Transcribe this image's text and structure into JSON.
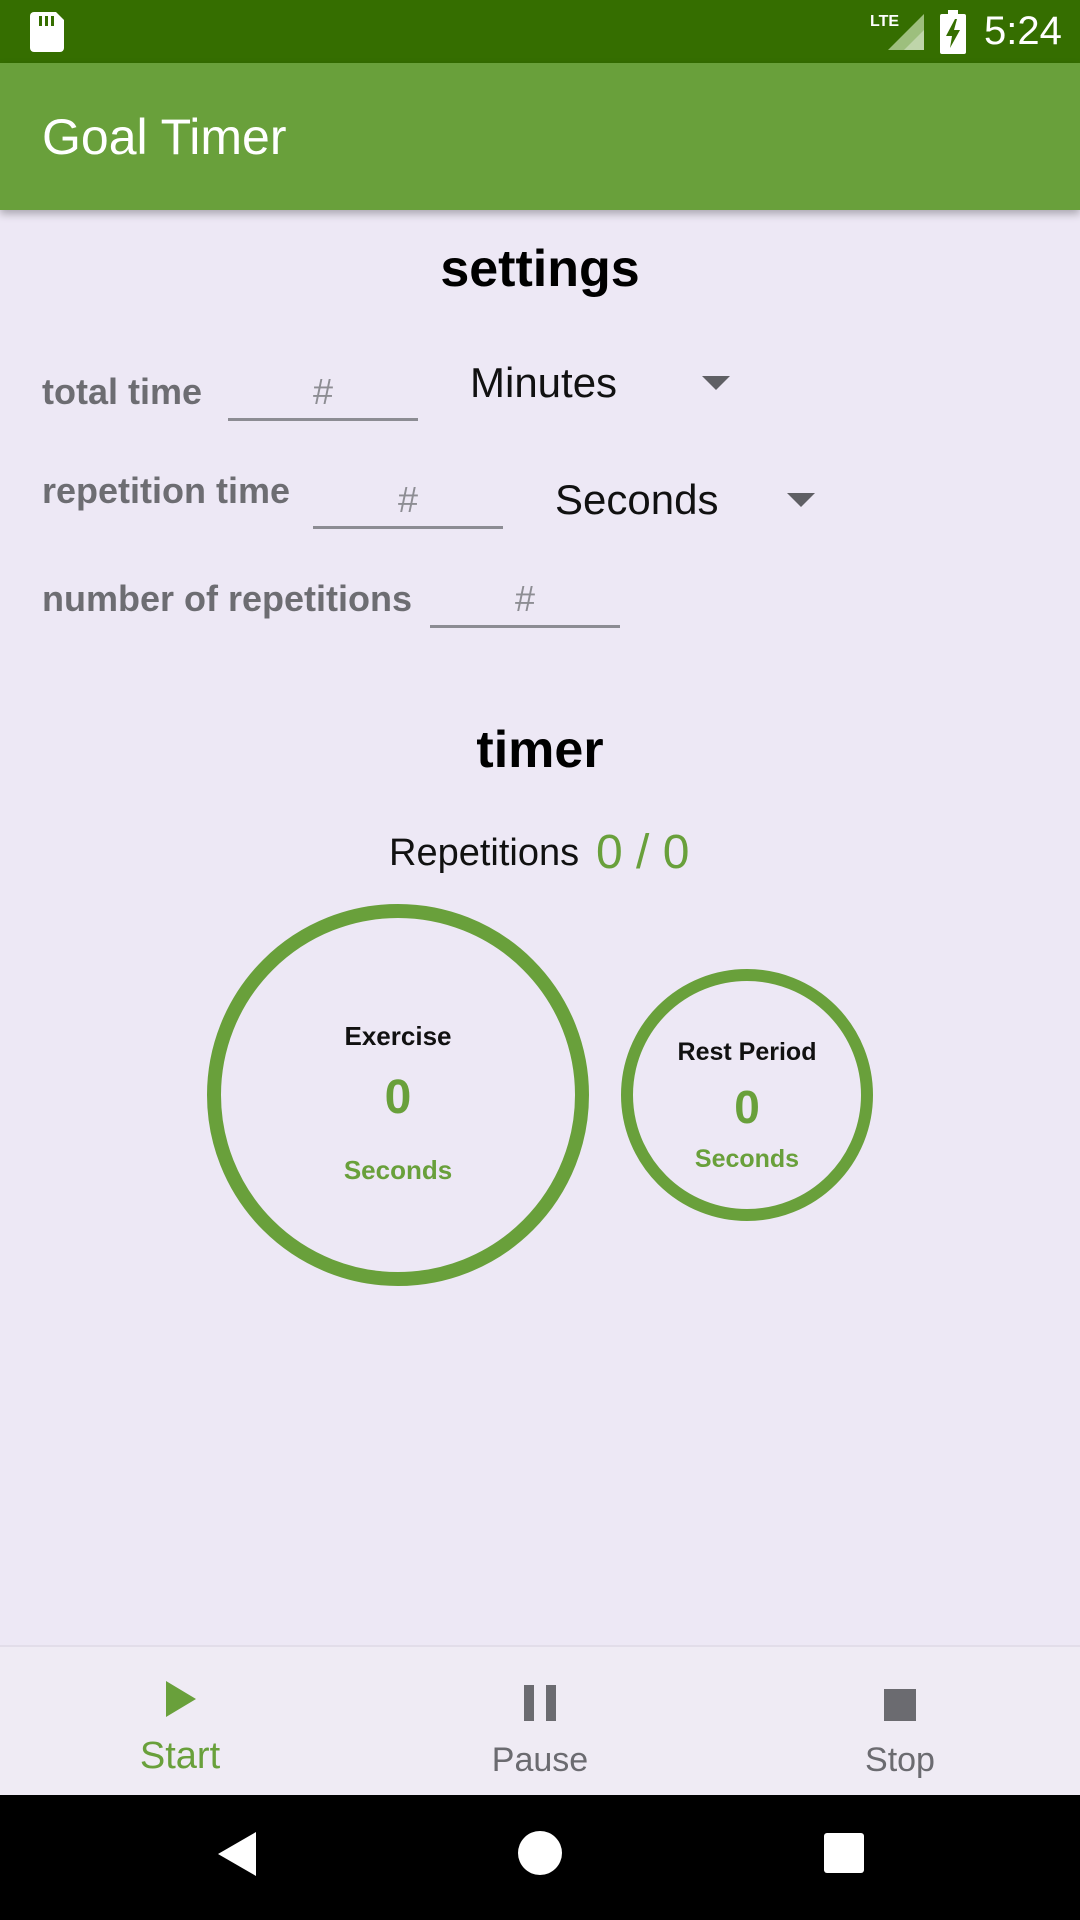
{
  "status_bar": {
    "time": "5:24",
    "network": "LTE",
    "icons": [
      "sd-card-icon",
      "lte-signal-icon",
      "battery-charging-icon"
    ]
  },
  "app_bar": {
    "title": "Goal Timer"
  },
  "settings": {
    "title": "settings",
    "total_time": {
      "label": "total time",
      "placeholder": "#",
      "value": "",
      "unit": "Minutes"
    },
    "repetition_time": {
      "label": "repetition time",
      "placeholder": "#",
      "value": "",
      "unit": "Seconds"
    },
    "number_of_repetitions": {
      "label": "number of repetitions",
      "placeholder": "#",
      "value": ""
    }
  },
  "timer": {
    "title": "timer",
    "repetitions_label": "Repetitions",
    "repetitions_value": "0 / 0",
    "exercise": {
      "title": "Exercise",
      "value": "0",
      "unit": "Seconds"
    },
    "rest": {
      "title": "Rest Period",
      "value": "0",
      "unit": "Seconds"
    }
  },
  "bottom_nav": {
    "items": [
      {
        "label": "Start",
        "icon": "play-icon",
        "selected": true
      },
      {
        "label": "Pause",
        "icon": "pause-icon",
        "selected": false
      },
      {
        "label": "Stop",
        "icon": "stop-icon",
        "selected": false
      }
    ]
  },
  "system_nav": {
    "icons": [
      "back-icon",
      "home-icon",
      "recents-icon"
    ]
  },
  "colors": {
    "status_bar": "#356e00",
    "app_bar": "#69a03b",
    "accent": "#69a03b",
    "background": "#ede8f5",
    "inactive": "#6b6b70"
  }
}
